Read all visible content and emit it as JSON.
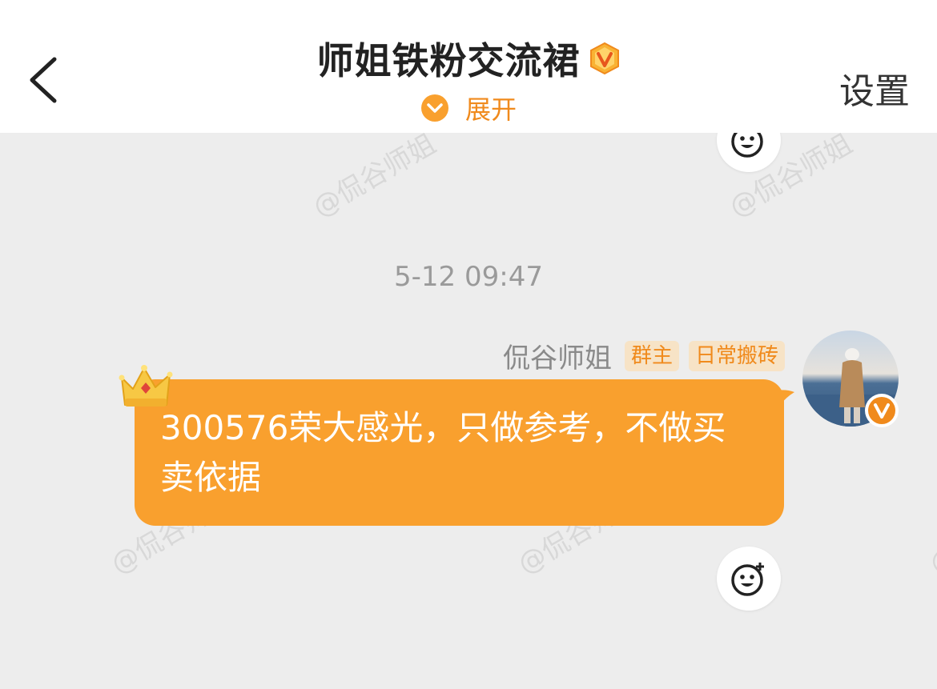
{
  "header": {
    "title": "师姐铁粉交流裙",
    "expand_label": "展开",
    "settings_label": "设置"
  },
  "watermark_text": "@侃谷师姐",
  "message": {
    "timestamp": "5-12 09:47",
    "sender_name": "侃谷师姐",
    "tags": [
      "群主",
      "日常搬砖"
    ],
    "text": "300576荣大感光，只做参考，不做买卖依据"
  },
  "colors": {
    "accent": "#f08a1c",
    "bubble": "#f9a02e",
    "background": "#ededed",
    "header_bg": "#ffffff",
    "tag_bg": "#f7e3c6"
  },
  "icons": {
    "back": "chevron-left-icon",
    "vip": "vip-badge-icon",
    "expand": "chevron-down-circle-icon",
    "reaction": "emoji-add-icon",
    "crown": "crown-icon",
    "verified": "verified-v-icon"
  }
}
